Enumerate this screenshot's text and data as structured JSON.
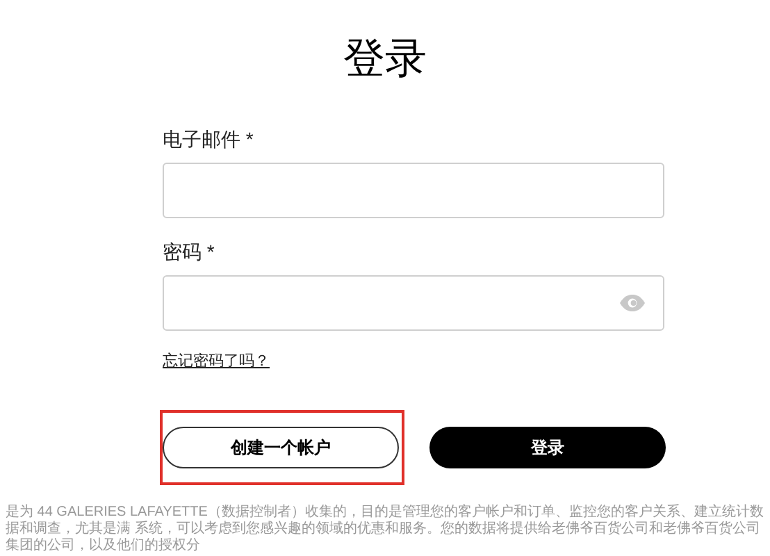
{
  "title": "登录",
  "fields": [
    {
      "label": "电子邮件 *",
      "kind": "text"
    },
    {
      "label": "密码 *",
      "kind": "password"
    }
  ],
  "forgot_link": "忘记密码了吗？",
  "buttons": [
    {
      "label": "创建一个帐户",
      "kind": "outline",
      "highlighted": true
    },
    {
      "label": "登录",
      "kind": "filled",
      "highlighted": false
    }
  ],
  "notice": "是为 44 GALERIES LAFAYETTE（数据控制者）收集的，目的是管理您的客户帐户和订单、监控您的客户关系、建立统计数据和调查，尤其是满 系统，可以考虑到您感兴趣的领域的优惠和服务。您的数据将提供给老佛爷百货公司和老佛爷百货公司集团的公司，以及他们的授权分"
}
